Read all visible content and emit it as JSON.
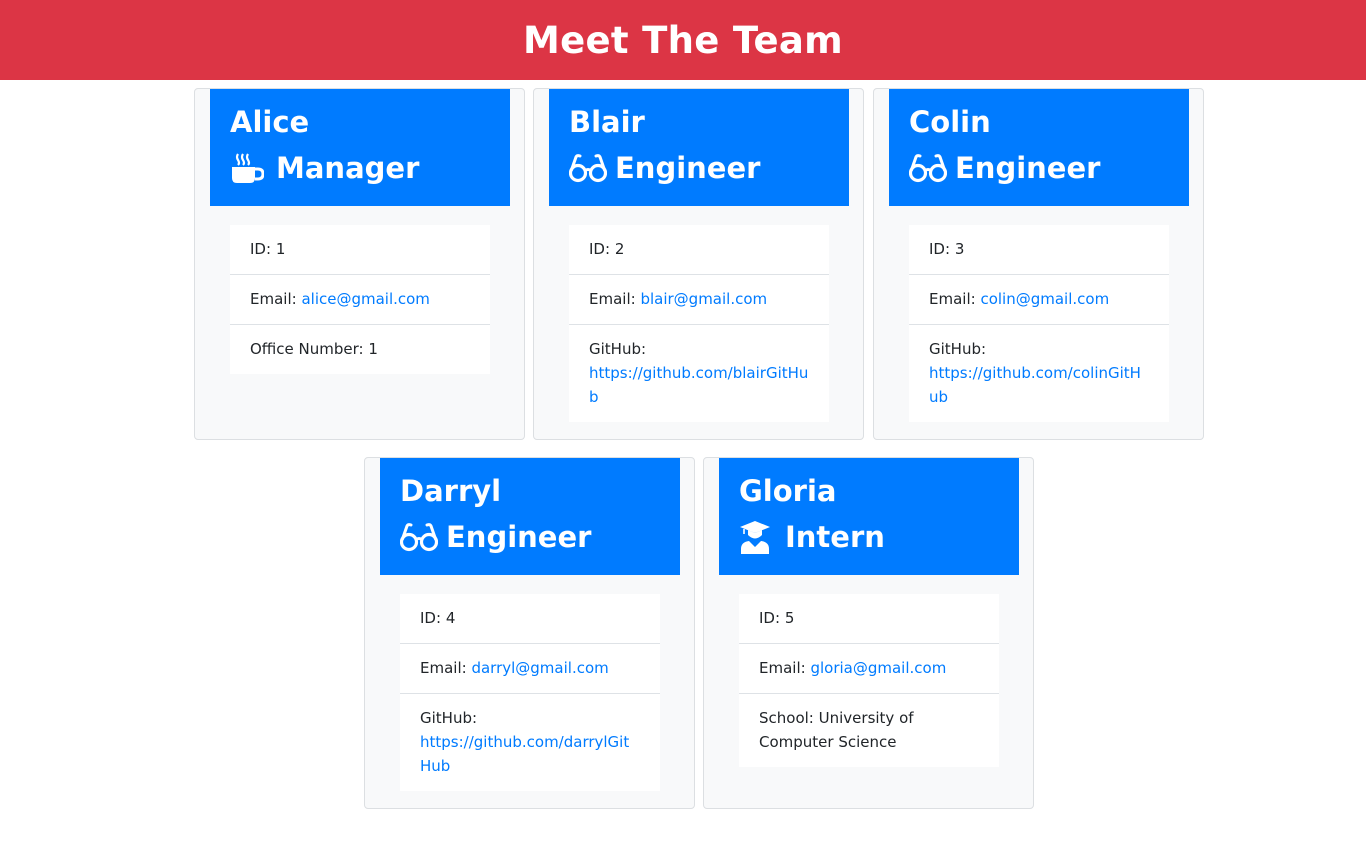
{
  "header": {
    "title": "Meet The Team"
  },
  "colors": {
    "header": "#dc3545",
    "card_header": "#007bff",
    "link": "#007bff"
  },
  "team": [
    {
      "name": "Alice",
      "role": "Manager",
      "icon": "coffee-icon",
      "id_label": "ID:",
      "id": "1",
      "email_label": "Email:",
      "email": "alice@gmail.com",
      "extra_label": "Office Number:",
      "extra": "1"
    },
    {
      "name": "Blair",
      "role": "Engineer",
      "icon": "glasses-icon",
      "id_label": "ID:",
      "id": "2",
      "email_label": "Email:",
      "email": "blair@gmail.com",
      "extra_label": "GitHub:",
      "extra": "https://github.com/blairGitHub"
    },
    {
      "name": "Colin",
      "role": "Engineer",
      "icon": "glasses-icon",
      "id_label": "ID:",
      "id": "3",
      "email_label": "Email:",
      "email": "colin@gmail.com",
      "extra_label": "GitHub:",
      "extra": "https://github.com/colinGitHub"
    },
    {
      "name": "Darryl",
      "role": "Engineer",
      "icon": "glasses-icon",
      "id_label": "ID:",
      "id": "4",
      "email_label": "Email:",
      "email": "darryl@gmail.com",
      "extra_label": "GitHub:",
      "extra": "https://github.com/darrylGitHub"
    },
    {
      "name": "Gloria",
      "role": "Intern",
      "icon": "graduate-icon",
      "id_label": "ID:",
      "id": "5",
      "email_label": "Email:",
      "email": "gloria@gmail.com",
      "extra_label": "School:",
      "extra": "University of Computer Science"
    }
  ]
}
